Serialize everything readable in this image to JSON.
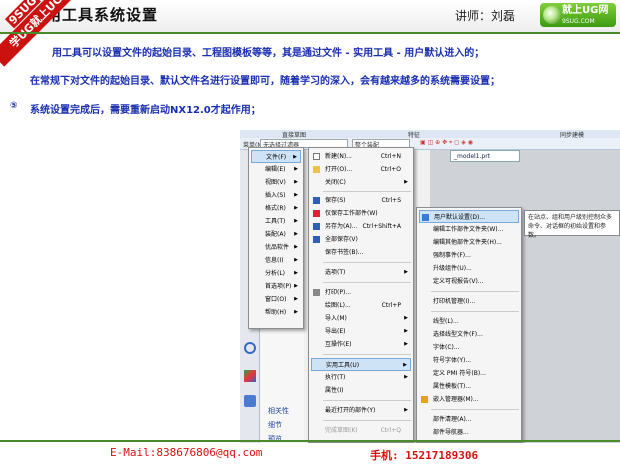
{
  "header": {
    "title": "用工具系统设置",
    "lecturer": "讲师：刘磊",
    "logo_text": "就上UG网",
    "logo_sub": "9SUG.COM",
    "ribbon_top": "9SUG",
    "ribbon_bottom": "学UG就上UG网"
  },
  "bullets": [
    {
      "text": "用工具可以设置文件的起始目录、工程图模板等等，其是通过文件 - 实用工具 - 用户默认进入的；"
    },
    {
      "text": "在常规下对文件的起始目录、默认文件名进行设置即可，随着学习的深入，会有越来越多的系统需要设置；"
    },
    {
      "mark": "⑤",
      "text": "系统设置完成后，需要重新启动NX12.0才起作用；"
    }
  ],
  "screenshot": {
    "tab_labels": [
      "直接草图",
      "特征",
      "同步建模"
    ],
    "menu_button": "菜单(M)▾",
    "filter_dropdown": "无选择过滤器",
    "assembly_dropdown": "整个装配",
    "doc_tab": "_model1.prt",
    "nav_items": [
      "相关性",
      "细节",
      "预览"
    ],
    "main_menu": [
      {
        "label": "文件(F)",
        "selected": true
      },
      {
        "label": "编辑(E)"
      },
      {
        "label": "视图(V)"
      },
      {
        "label": "插入(S)"
      },
      {
        "label": "格式(R)"
      },
      {
        "label": "工具(T)"
      },
      {
        "label": "装配(A)"
      },
      {
        "label": "优品软件"
      },
      {
        "label": "信息(I)"
      },
      {
        "label": "分析(L)"
      },
      {
        "label": "首选项(P)"
      },
      {
        "label": "窗口(O)"
      },
      {
        "label": "帮助(H)"
      }
    ],
    "file_menu": [
      {
        "label": "新建(N)...",
        "shortcut": "Ctrl+N"
      },
      {
        "label": "打开(O)...",
        "shortcut": "Ctrl+O"
      },
      {
        "label": "关闭(C)"
      },
      {
        "label": "保存(S)",
        "shortcut": "Ctrl+S"
      },
      {
        "label": "仅保存工作部件(W)"
      },
      {
        "label": "另存为(A)...",
        "shortcut": "Ctrl+Shift+A"
      },
      {
        "label": "全部保存(V)"
      },
      {
        "label": "保存书签(B)..."
      },
      {
        "label": "选项(T)"
      },
      {
        "label": "打印(P)..."
      },
      {
        "label": "绘图(L)...",
        "shortcut": "Ctrl+P"
      },
      {
        "label": "导入(M)"
      },
      {
        "label": "导出(E)"
      },
      {
        "label": "互操作(E)"
      },
      {
        "label": "实用工具(U)",
        "selected": true
      },
      {
        "label": "执行(T)"
      },
      {
        "label": "属性(I)"
      },
      {
        "label": "最近打开的部件(Y)"
      },
      {
        "label": "完成草图(K)",
        "shortcut": "Ctrl+Q"
      }
    ],
    "utilities_menu": [
      {
        "label": "用户默认设置(D)...",
        "selected": true
      },
      {
        "label": "编辑工作部件文件夹(W)..."
      },
      {
        "label": "编辑其他部件文件夹(H)..."
      },
      {
        "label": "强制事件(F)..."
      },
      {
        "label": "升级组件(U)..."
      },
      {
        "label": "定义可视报告(V)..."
      },
      {
        "label": "打印机管理(I)..."
      },
      {
        "label": "线型(L)..."
      },
      {
        "label": "选择线型文件(F)..."
      },
      {
        "label": "字体(C)..."
      },
      {
        "label": "符号字体(Y)..."
      },
      {
        "label": "定义 PMI 符号(B)..."
      },
      {
        "label": "属性模板(T)..."
      },
      {
        "label": "嵌入管理器(M)..."
      },
      {
        "label": "部件清理(A)..."
      },
      {
        "label": "部件导航器..."
      }
    ],
    "tooltip": "在站点、组和用户级别控制众多命令、对话框的初始设置和参数。"
  },
  "footer": {
    "email": "E-Mail:838676806@qq.com",
    "phone": "手机: 15217189306"
  },
  "colors": {
    "bullet_text": "#1a2fb0",
    "footer_text": "#d81010",
    "rule_line": "#4a8a2a",
    "ribbon": "#cc1111"
  }
}
